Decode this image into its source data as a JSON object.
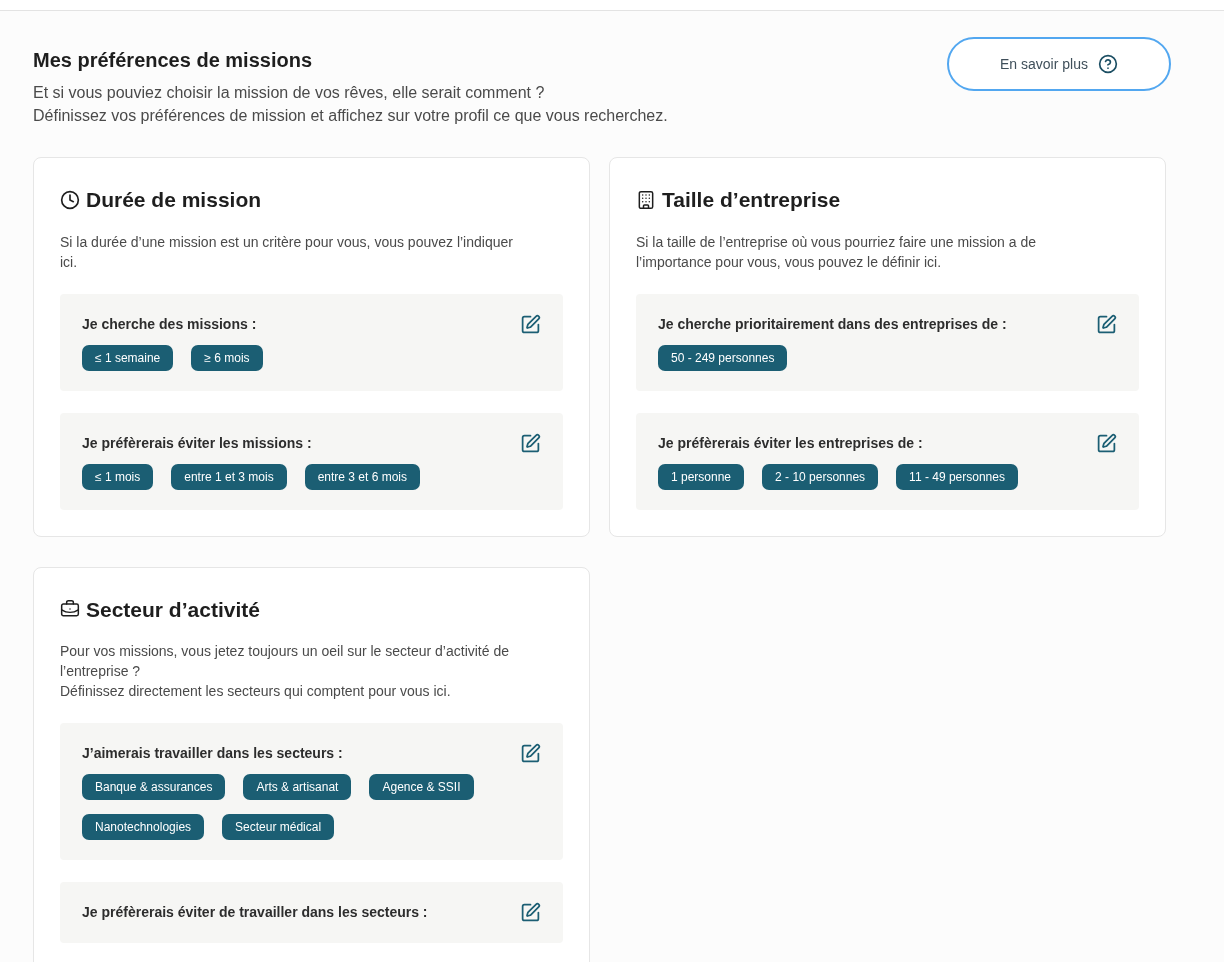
{
  "header": {
    "title": "Mes préférences de missions",
    "lines": [
      "Et si vous pouviez choisir la mission de vos rêves, elle serait comment ?",
      "Définissez vos préférences de mission et affichez sur votre profil ce que vous recherchez."
    ],
    "button": "En savoir plus"
  },
  "cards": [
    {
      "kind": "duration",
      "title": "Durée de mission",
      "description": [
        "Si la durée d’une mission est un critère pour vous, vous pouvez l’indiquer ici."
      ],
      "blocks": [
        {
          "label": "Je cherche des missions :",
          "tags": [
            "≤ 1 semaine",
            "≥ 6 mois"
          ]
        },
        {
          "label": "Je préfèrerais éviter les missions :",
          "tags": [
            "≤ 1 mois",
            "entre 1 et 3 mois",
            "entre 3 et 6 mois"
          ]
        }
      ]
    },
    {
      "kind": "company",
      "title": "Taille d’entreprise",
      "description": [
        "Si la taille de l’entreprise où vous pourriez faire une mission a de l’importance pour vous, vous pouvez le définir ici."
      ],
      "blocks": [
        {
          "label": "Je cherche prioritairement dans des entreprises de :",
          "tags": [
            "50 - 249 personnes"
          ]
        },
        {
          "label": "Je préfèrerais éviter les entreprises de :",
          "tags": [
            "1 personne",
            "2 - 10 personnes",
            "11 - 49 personnes"
          ]
        }
      ]
    },
    {
      "kind": "sector",
      "title": "Secteur d’activité",
      "description": [
        "Pour vos missions, vous jetez toujours un oeil sur le secteur d’activité de l’entreprise ?",
        "Définissez directement les secteurs qui comptent pour vous ici."
      ],
      "blocks": [
        {
          "label": "J’aimerais travailler dans les secteurs :",
          "tags": [
            "Banque & assurances",
            "Arts & artisanat",
            "Agence & SSII",
            "Nanotechnologies",
            "Secteur médical"
          ]
        },
        {
          "label": "Je préfèrerais éviter de travailler dans les secteurs :"
        }
      ]
    }
  ]
}
